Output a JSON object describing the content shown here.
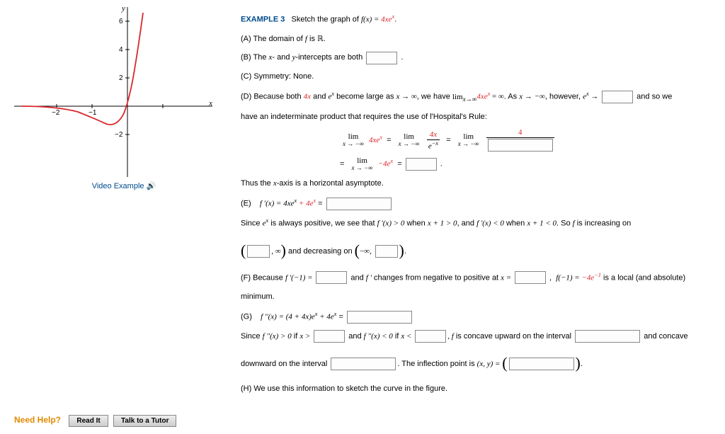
{
  "example_label": "EXAMPLE 3",
  "example_prompt_prefix": "Sketch the graph of ",
  "fn_lhs": "f(x) = ",
  "fn_rhs": "4xe",
  "fn_exp": "x",
  "video_link": "Video Example",
  "sections": {
    "A": "(A) The domain of ",
    "A_tail": " is ",
    "A_real": "ℝ",
    "B": "(B) The ",
    "B_mid": "- and ",
    "B_mid2": "-intercepts are both ",
    "C": "(C) Symmetry: None.",
    "D1": "(D) Because both ",
    "D1_mid": " and ",
    "D1_mid2": " become large as ",
    "D1_mid3": ", we have ",
    "D1_mid4": ". As ",
    "D1_mid5": ", however, ",
    "D1_tail": " and so we",
    "D2": "have an indeterminate product that requires the use of l'Hospital's Rule:",
    "D_thus": "Thus the ",
    "D_thus2": "-axis is a horizontal asymptote.",
    "E_label": "(E)",
    "E_since1": "Since ",
    "E_since2": " is always positive, we see that ",
    "E_since3": " when ",
    "E_since4": ", and ",
    "E_since5": " when ",
    "E_since6": ". So ",
    "E_since7": " is increasing on",
    "E_dec": " and decreasing on ",
    "F1": "(F) Because ",
    "F2": " and ",
    "F3": " changes from negative to positive at ",
    "F4": " is a local (and absolute)",
    "F5": "minimum.",
    "G_label": "(G)",
    "G_since1": "Since ",
    "G_since2": " if ",
    "G_since3": " and ",
    "G_since4": " if ",
    "G_since5": " is concave upward on the interval ",
    "G_since6": " and concave",
    "G_down": "downward on the interval ",
    "G_infl": ". The inflection point is ",
    "H": "(H) We use this information to sketch the curve in the figure."
  },
  "math_text": {
    "f": "f",
    "x": "x",
    "y": "y",
    "ex": "e",
    "four_x": "4x",
    "xto_inf": "x → ∞",
    "xto_ninf": "x → −∞",
    "lim": "lim",
    "limx_ninf": "x → −∞",
    "four_xex": "4xe",
    "eq_inf": " = ∞",
    "ex_to": "e",
    "arrow": " → ",
    "neg4ex": "−4e",
    "fpx": "f '(x) = 4xe",
    "plus4ex": " + 4e",
    "fpx_gt0": "f '(x) > 0",
    "x1_gt0": "x + 1 > 0",
    "fpx_lt0": "f '(x) < 0",
    "x1_lt0": "x + 1 < 0",
    "comma_inf": ", ∞",
    "neg_inf_comma": "−∞, ",
    "fp_neg1": "f '(−1) = ",
    "fprime": "f '",
    "x_eq": "x = ",
    "f_neg1_val": "f(−1) = ",
    "val_neg4e1": "−4e",
    "neg1": "−1",
    "fppx": "f ''(x) = (4 + 4x)e",
    "fppx_gt0": "f ''(x) > 0",
    "x_gt": "x > ",
    "fppx_lt0": "f ''(x) < 0",
    "x_lt": "x < ",
    "f_comma": ", f",
    "xy_eq": "(x, y) = ",
    "four": "4",
    "e_neg_x": "e",
    "neg_x": "−x"
  },
  "ticks": {
    "n2": "−2",
    "n1": "−1",
    "t2": "2",
    "t4": "4",
    "t6": "6",
    "tn2": "−2"
  },
  "need_help": {
    "label": "Need Help?",
    "read": "Read It",
    "tutor": "Talk to a Tutor"
  }
}
